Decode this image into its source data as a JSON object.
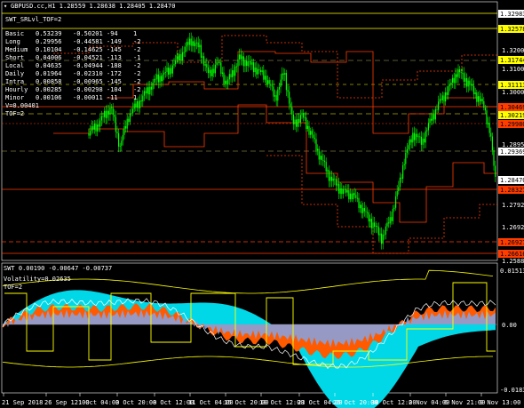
{
  "window": {
    "symbol_header": "GBPUSD.cc,H1  1.28559 1.28638 1.28405 1.28470"
  },
  "colors": {
    "background": "#000000",
    "candle": "#00ff00",
    "level_red": "#ff3c00",
    "level_yellow": "#ffff00",
    "dotted_red": "#ff3c00",
    "dashed_khaki": "#b8b060",
    "cyan_fill": "#00d8e8",
    "orange_fill": "#ff5a00",
    "steel_fill": "#8aa0d8",
    "text": "#ffffff",
    "grid": "#303030"
  },
  "indicator_main": {
    "title": "SWT_SRLvl_TOF=2",
    "rows": [
      {
        "name": "Basic",
        "v1": "0.53239",
        "v2": "-0.50201",
        "v3": "-94",
        "v4": "1"
      },
      {
        "name": "Long",
        "v1": "0.29956",
        "v2": "-0.44581",
        "v3": "-149",
        "v4": "-2"
      },
      {
        "name": "Medium",
        "v1": "0.10104",
        "v2": "-0.14625",
        "v3": "-145",
        "v4": "-2"
      },
      {
        "name": "Short",
        "v1": "0.04006",
        "v2": "-0.04521",
        "v3": "-113",
        "v4": "-1"
      },
      {
        "name": "Local",
        "v1": "0.04635",
        "v2": "-0.04944",
        "v3": "-188",
        "v4": "-2"
      },
      {
        "name": "Daily",
        "v1": "0.01964",
        "v2": "-0.02310",
        "v3": "-172",
        "v4": "-2"
      },
      {
        "name": "Intra",
        "v1": "0.00858",
        "v2": "-0.00965",
        "v3": "-145",
        "v4": "-2"
      },
      {
        "name": "Hourly",
        "v1": "0.00285",
        "v2": "-0.00298",
        "v3": "-104",
        "v4": "-2"
      },
      {
        "name": "Minor",
        "v1": "0.00106",
        "v2": "-0.00011",
        "v3": "-11",
        "v4": "1"
      }
    ],
    "v_line": "V=0.00401",
    "tof_line": "TOF=2"
  },
  "indicator_sub": {
    "header": "SWT 0.00190 -0.00647 -0.00737",
    "volatility": "Volatility=0.02635",
    "tof": "TOF=2"
  },
  "price_axis": {
    "ticks": [
      "1.32000",
      "1.31000",
      "1.30000",
      "1.28950",
      "1.27920",
      "1.26920",
      "1.25880"
    ],
    "tags": [
      {
        "text": "1.32983",
        "kind": "white"
      },
      {
        "text": "1.32578",
        "kind": "yellow"
      },
      {
        "text": "1.31744",
        "kind": "yellow"
      },
      {
        "text": "1.31113",
        "kind": "yellow"
      },
      {
        "text": "1.30469",
        "kind": "red"
      },
      {
        "text": "1.30219",
        "kind": "yellow"
      },
      {
        "text": "1.29980",
        "kind": "red"
      },
      {
        "text": "1.29369",
        "kind": "white"
      },
      {
        "text": "1.28470",
        "kind": "white"
      },
      {
        "text": "1.28327",
        "kind": "red"
      },
      {
        "text": "1.26927",
        "kind": "red"
      },
      {
        "text": "1.26616",
        "kind": "red"
      }
    ]
  },
  "sub_axis": {
    "ticks": [
      "1.26405",
      "0.01513",
      "0.00",
      "-0.01834"
    ]
  },
  "time_axis": {
    "ticks": [
      "21 Sep 2018",
      "26 Sep 12:00",
      "1 Oct 04:00",
      "3 Oct 20:00",
      "8 Oct 12:00",
      "11 Oct 04:00",
      "15 Oct 20:00",
      "18 Oct 12:00",
      "23 Oct 04:00",
      "25 Oct 20:00",
      "30 Oct 12:00",
      "2 Nov 04:00",
      "6 Nov 21:00",
      "9 Nov 13:00"
    ]
  }
}
